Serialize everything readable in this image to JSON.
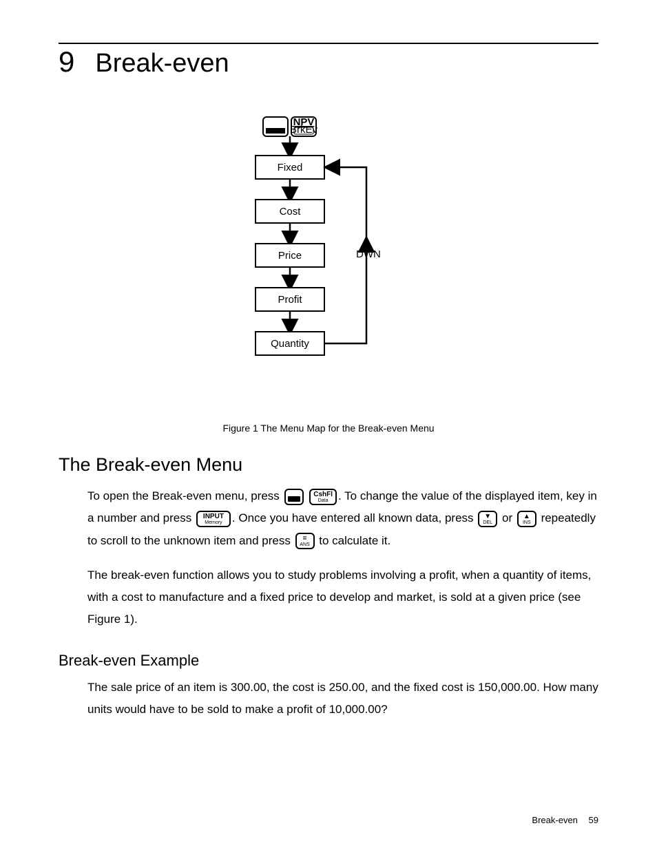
{
  "chapter": {
    "number": "9",
    "title": "Break-even"
  },
  "figure": {
    "caption": "Figure 1  The Menu Map for the Break-even Menu",
    "entry_key": {
      "top": "NPV",
      "bottom": "BrkEv"
    },
    "nodes": [
      "Fixed",
      "Cost",
      "Price",
      "Profit",
      "Quantity"
    ],
    "side_label": "DWN"
  },
  "section1": {
    "heading": "The Break-even Menu"
  },
  "keys": {
    "cshfl": {
      "top": "CshFl",
      "bottom": "Data"
    },
    "input": {
      "top": "INPUT",
      "bottom": "Memory"
    },
    "down": {
      "top": "▼",
      "bottom": "DEL"
    },
    "up": {
      "top": "▲",
      "bottom": "INS"
    },
    "equals": {
      "top": "=",
      "bottom": "ANS"
    }
  },
  "para1": {
    "a": "To open the Break-even menu, press ",
    "b": ". To change the value of the displayed item, key in a number and press ",
    "c": ". Once you have entered all known data, press ",
    "d": " or ",
    "e": " repeatedly to scroll to the unknown item and press ",
    "f": " to calculate it."
  },
  "para2": "The break-even function allows you to study problems involving a profit, when a quantity of items, with a cost to manufacture and a fixed price to develop and market, is sold at a given price (see Figure 1).",
  "section2": {
    "heading": "Break-even Example"
  },
  "para3": "The sale price of an item is 300.00, the cost is 250.00, and the fixed cost is 150,000.00. How many units would have to be sold to make a profit of 10,000.00?",
  "footer": {
    "label": "Break-even",
    "page": "59"
  },
  "chart_data": {
    "type": "diagram",
    "title": "The Menu Map for the Break-even Menu",
    "entry": "NPV / BrkEv",
    "sequence": [
      "Fixed",
      "Cost",
      "Price",
      "Profit",
      "Quantity"
    ],
    "loop_label": "DWN",
    "loop_from": "Quantity",
    "loop_to": "Fixed"
  }
}
